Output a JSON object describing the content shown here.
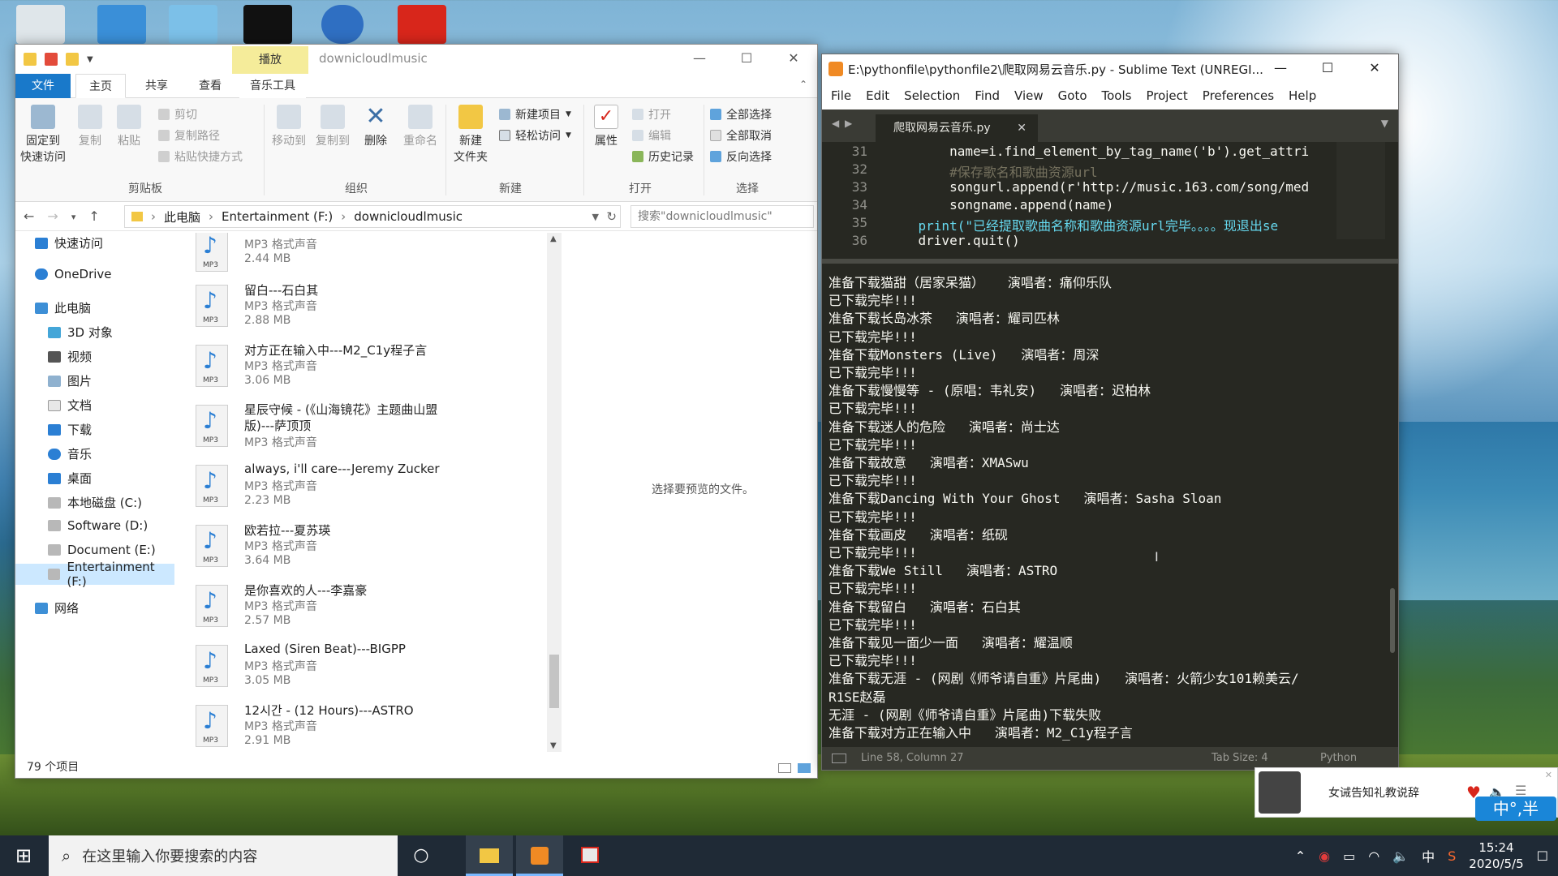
{
  "explorer": {
    "title": "downicloudlmusic",
    "context_tab": "播放",
    "tabs": [
      "文件",
      "主页",
      "共享",
      "查看",
      "音乐工具"
    ],
    "ribbon": {
      "pin": "固定到\n快速访问",
      "copy": "复制",
      "paste": "粘贴",
      "cut": "剪切",
      "copy_path": "复制路径",
      "paste_shortcut": "粘贴快捷方式",
      "clipboard": "剪贴板",
      "move_to": "移动到",
      "copy_to": "复制到",
      "delete": "删除",
      "rename": "重命名",
      "organize": "组织",
      "new_item": "新建项目",
      "easy_access": "轻松访问",
      "new_folder": "新建\n文件夹",
      "new": "新建",
      "properties": "属性",
      "open": "打开",
      "edit": "编辑",
      "history": "历史记录",
      "open_group": "打开",
      "select_all": "全部选择",
      "select_none": "全部取消",
      "invert": "反向选择",
      "select_group": "选择"
    },
    "address": [
      "此电脑",
      "Entertainment (F:)",
      "downicloudlmusic"
    ],
    "search_placeholder": "搜索\"downicloudlmusic\"",
    "nav": [
      "快速访问",
      "OneDrive",
      "此电脑",
      "3D 对象",
      "视频",
      "图片",
      "文档",
      "下载",
      "音乐",
      "桌面",
      "本地磁盘 (C:)",
      "Software (D:)",
      "Document (E:)",
      "Entertainment (F:)",
      "网络"
    ],
    "files": [
      {
        "name": "",
        "type": "MP3 格式声音",
        "size": "2.44 MB"
      },
      {
        "name": "留白---石白其",
        "type": "MP3 格式声音",
        "size": "2.88 MB"
      },
      {
        "name": "对方正在输入中---M2_C1y程子言",
        "type": "MP3 格式声音",
        "size": "3.06 MB"
      },
      {
        "name": "星辰守候 - (《山海镜花》主题曲山盟版)---萨顶顶",
        "type": "MP3 格式声音",
        "size": ""
      },
      {
        "name": "always, i'll care---Jeremy Zucker",
        "type": "MP3 格式声音",
        "size": "2.23 MB"
      },
      {
        "name": "欧若拉---夏苏瑛",
        "type": "MP3 格式声音",
        "size": "3.64 MB"
      },
      {
        "name": "是你喜欢的人---李嘉豪",
        "type": "MP3 格式声音",
        "size": "2.57 MB"
      },
      {
        "name": "Laxed (Siren Beat)---BIGPP",
        "type": "MP3 格式声音",
        "size": "3.05 MB"
      },
      {
        "name": "12시간 - (12 Hours)---ASTRO",
        "type": "MP3 格式声音",
        "size": "2.91 MB"
      }
    ],
    "preview_text": "选择要预览的文件。",
    "status": "79 个项目"
  },
  "sublime": {
    "title": "E:\\pythonfile\\pythonfile2\\爬取网易云音乐.py - Sublime Text (UNREGI...",
    "menu": [
      "File",
      "Edit",
      "Selection",
      "Find",
      "View",
      "Goto",
      "Tools",
      "Project",
      "Preferences",
      "Help"
    ],
    "tab": "爬取网易云音乐.py",
    "code": [
      {
        "ln": "31",
        "text": "        name=i.find_element_by_tag_name('b').get_attri"
      },
      {
        "ln": "32",
        "text": "        #保存歌名和歌曲资源url"
      },
      {
        "ln": "33",
        "text": "        songurl.append(r'http://music.163.com/song/med"
      },
      {
        "ln": "34",
        "text": "        songname.append(name)"
      },
      {
        "ln": "35",
        "text": "    print(\"已经提取歌曲名称和歌曲资源url完毕。。。。现退出se"
      },
      {
        "ln": "36",
        "text": "    driver.quit()"
      }
    ],
    "console": [
      "准备下载猫甜（居家呆猫）   演唱者：痛仰乐队",
      "已下载完毕!!!",
      "准备下载长岛冰茶   演唱者：耀司匹林",
      "已下载完毕!!!",
      "准备下载Monsters (Live)   演唱者：周深",
      "已下载完毕!!!",
      "准备下载慢慢等 - (原唱：韦礼安)   演唱者：迟柏林",
      "已下载完毕!!!",
      "准备下载迷人的危险   演唱者：尚士达",
      "已下载完毕!!!",
      "准备下载故意   演唱者：XMASwu",
      "已下载完毕!!!",
      "准备下载Dancing With Your Ghost   演唱者：Sasha Sloan",
      "已下载完毕!!!",
      "准备下载画皮   演唱者：纸砚",
      "已下载完毕!!!",
      "准备下载We Still   演唱者：ASTRO",
      "已下载完毕!!!",
      "准备下载留白   演唱者：石白其",
      "已下载完毕!!!",
      "准备下载见一面少一面   演唱者：耀温顺",
      "已下载完毕!!!",
      "准备下载无涯 - (网剧《师爷请自重》片尾曲)   演唱者：火箭少女101赖美云/",
      "R1SE赵磊",
      "无涯 - (网剧《师爷请自重》片尾曲)下载失败",
      "准备下载对方正在输入中   演唱者：M2_C1y程子言"
    ],
    "status_pos": "Line 58, Column 27",
    "status_tab": "Tab Size: 4",
    "status_lang": "Python"
  },
  "notification": {
    "text": "女诫告知礼教说辞"
  },
  "ime": "中°,半",
  "taskbar": {
    "search_placeholder": "在这里输入你要搜索的内容",
    "ime_tray": "中",
    "time": "15:24",
    "date": "2020/5/5"
  }
}
